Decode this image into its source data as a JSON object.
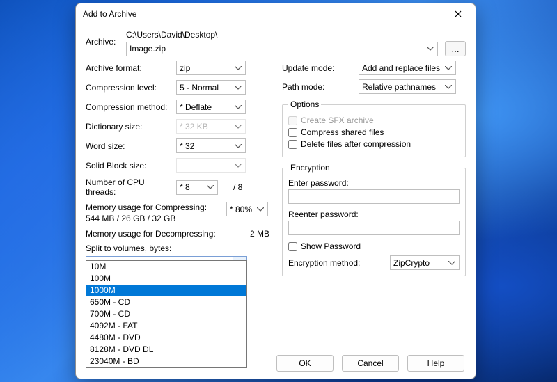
{
  "window": {
    "title": "Add to Archive"
  },
  "archive": {
    "label": "Archive:",
    "path": "C:\\Users\\David\\Desktop\\",
    "filename": "Image.zip",
    "browse": "..."
  },
  "left": {
    "format_label": "Archive format:",
    "format_value": "zip",
    "level_label": "Compression level:",
    "level_value": "5 - Normal",
    "method_label": "Compression method:",
    "method_value": "*  Deflate",
    "dict_label": "Dictionary size:",
    "dict_value": "*  32 KB",
    "word_label": "Word size:",
    "word_value": "*  32",
    "solid_label": "Solid Block size:",
    "solid_value": "",
    "threads_label": "Number of CPU threads:",
    "threads_value": "*  8",
    "threads_total": "/ 8",
    "mem_compress_label": "Memory usage for Compressing:",
    "mem_compress_detail": "544 MB / 26 GB / 32 GB",
    "mem_percent": "*  80%",
    "mem_decompress_label": "Memory usage for Decompressing:",
    "mem_decompress_value": "2 MB",
    "split_label": "Split to volumes, bytes:",
    "split_value": "",
    "split_options": [
      "10M",
      "100M",
      "1000M",
      "650M - CD",
      "700M - CD",
      "4092M - FAT",
      "4480M - DVD",
      "8128M - DVD DL",
      "23040M - BD"
    ],
    "split_highlight_index": 2
  },
  "right": {
    "update_label": "Update mode:",
    "update_value": "Add and replace files",
    "path_label": "Path mode:",
    "path_value": "Relative pathnames",
    "options_legend": "Options",
    "opt_sfx": "Create SFX archive",
    "opt_shared": "Compress shared files",
    "opt_delete": "Delete files after compression",
    "enc_legend": "Encryption",
    "enter_pw": "Enter password:",
    "reenter_pw": "Reenter password:",
    "show_pw": "Show Password",
    "enc_method_label": "Encryption method:",
    "enc_method_value": "ZipCrypto"
  },
  "footer": {
    "ok": "OK",
    "cancel": "Cancel",
    "help": "Help"
  }
}
